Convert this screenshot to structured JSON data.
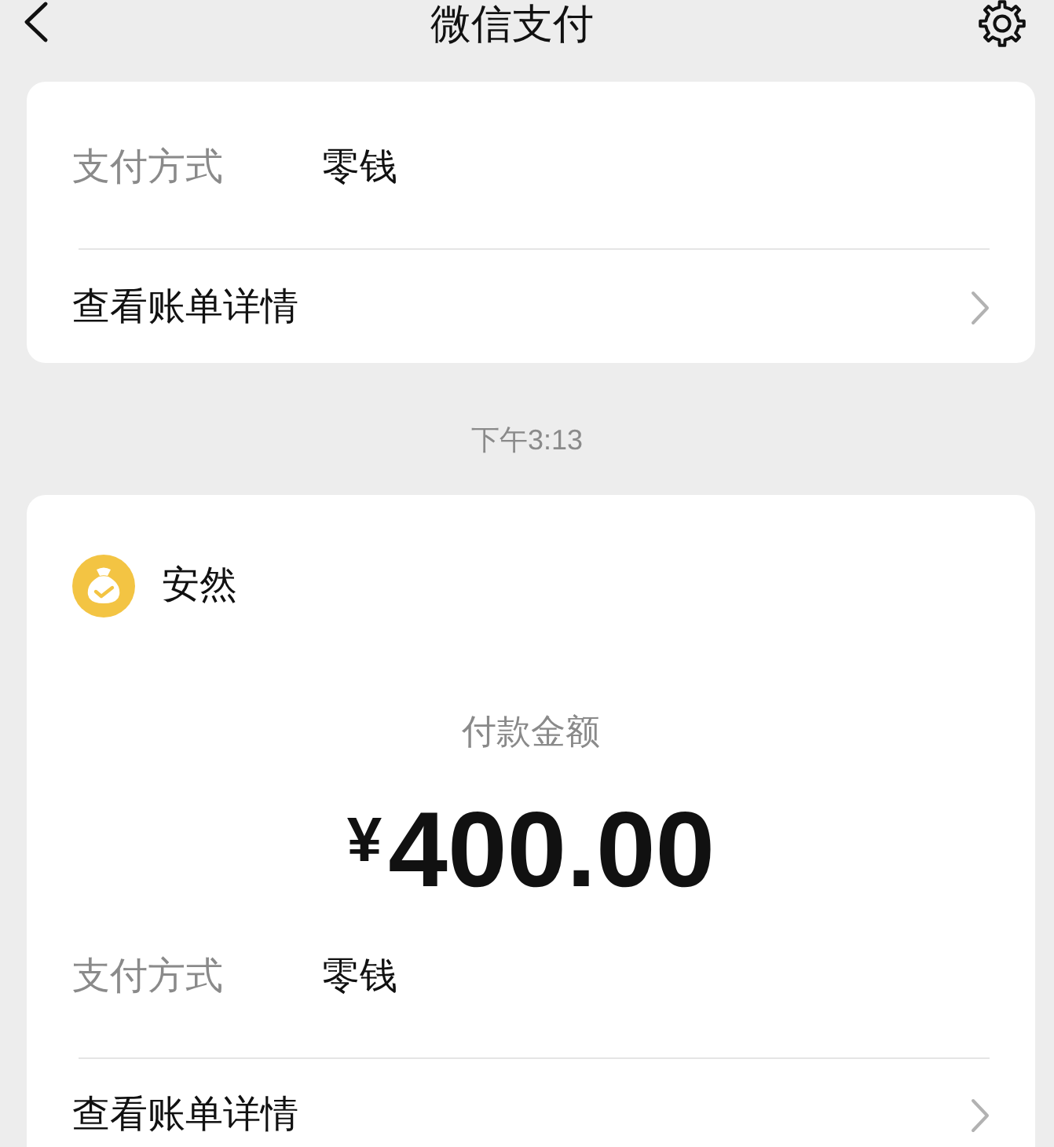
{
  "nav": {
    "title": "微信支付"
  },
  "messages": [
    {
      "details": [
        {
          "kind": "field",
          "label": "支付方式",
          "value": "零钱"
        },
        {
          "kind": "link",
          "label": "查看账单详情"
        }
      ]
    },
    {
      "time": "下午3:13",
      "sender": {
        "name": "安然"
      },
      "amount_label": "付款金额",
      "amount": "$^{¥}$400.00",
      "details": [
        {
          "kind": "field",
          "label": "支付方式",
          "value": "零钱"
        },
        {
          "kind": "link",
          "label": "查看账单详情"
        }
      ]
    }
  ]
}
